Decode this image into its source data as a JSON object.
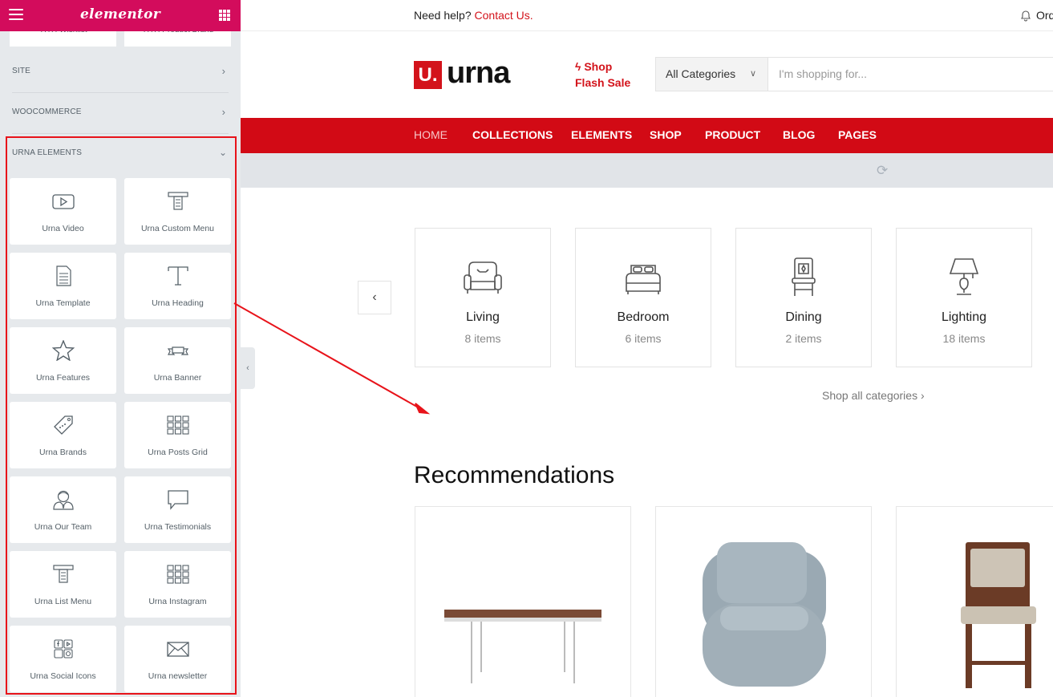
{
  "panel": {
    "logo": "elementor",
    "partial_cards": [
      "YITH Wishlist",
      "YITH Product Brand"
    ],
    "categories": [
      {
        "label": "SITE"
      },
      {
        "label": "WOOCOMMERCE"
      }
    ],
    "urna_title": "URNA ELEMENTS",
    "widgets": [
      {
        "label": "Urna Video",
        "icon": "video-icon"
      },
      {
        "label": "Urna Custom Menu",
        "icon": "custom-menu-icon"
      },
      {
        "label": "Urna Template",
        "icon": "template-icon"
      },
      {
        "label": "Urna Heading",
        "icon": "heading-icon"
      },
      {
        "label": "Urna Features",
        "icon": "star-icon"
      },
      {
        "label": "Urna Banner",
        "icon": "banner-icon"
      },
      {
        "label": "Urna Brands",
        "icon": "tag-icon"
      },
      {
        "label": "Urna Posts Grid",
        "icon": "grid-icon"
      },
      {
        "label": "Urna Our Team",
        "icon": "team-icon"
      },
      {
        "label": "Urna Testimonials",
        "icon": "speech-bubble-icon"
      },
      {
        "label": "Urna List Menu",
        "icon": "list-menu-icon"
      },
      {
        "label": "Urna Instagram",
        "icon": "instagram-grid-icon"
      },
      {
        "label": "Urna Social Icons",
        "icon": "social-icons-icon"
      },
      {
        "label": "Urna newsletter",
        "icon": "envelope-icon"
      }
    ]
  },
  "site": {
    "topbar": {
      "help_text": "Need help?",
      "help_link": "Contact Us.",
      "order_text": "Ord"
    },
    "logo": {
      "mark": "U.",
      "text": "urna"
    },
    "flash": {
      "line1": "Shop",
      "line2": "Flash Sale"
    },
    "search": {
      "category": "All Categories",
      "placeholder": "I'm shopping for..."
    },
    "nav": [
      "HOME",
      "COLLECTIONS",
      "ELEMENTS",
      "SHOP",
      "PRODUCT",
      "BLOG",
      "PAGES"
    ],
    "categories": [
      {
        "name": "Living",
        "count": "8 items",
        "icon": "armchair-icon"
      },
      {
        "name": "Bedroom",
        "count": "6 items",
        "icon": "bed-icon"
      },
      {
        "name": "Dining",
        "count": "2 items",
        "icon": "dining-chair-icon"
      },
      {
        "name": "Lighting",
        "count": "18 items",
        "icon": "lamp-icon"
      }
    ],
    "shop_all": "Shop all categories",
    "recommendations_title": "Recommendations"
  },
  "colors": {
    "elementor_pink": "#d30c5c",
    "brand_red": "#d20a15",
    "highlight_red": "#e8131a",
    "panel_bg": "#e6e9ec"
  }
}
